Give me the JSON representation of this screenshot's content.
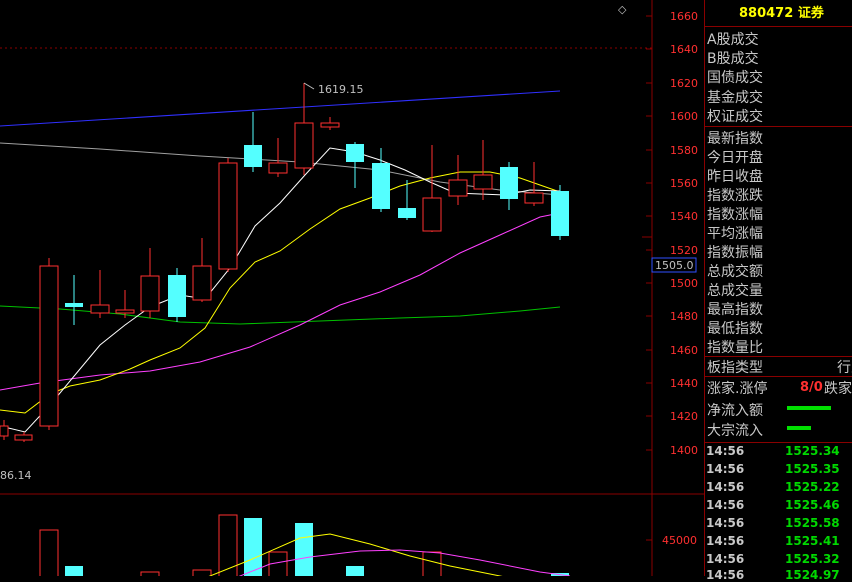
{
  "header": {
    "code": "880472",
    "name": "证券",
    "diamond": "◇"
  },
  "axis": {
    "labels": [
      "1660",
      "1640",
      "1620",
      "1600",
      "1580",
      "1560",
      "1540",
      "1520",
      "1500",
      "1480",
      "1460",
      "1440",
      "1420",
      "1400"
    ]
  },
  "current_price_label": "1505.0",
  "annotations": {
    "high": "1619.15",
    "low": "86.14"
  },
  "volume_axis": {
    "label": "45000"
  },
  "info_labels": [
    "A股成交",
    "B股成交",
    "国债成交",
    "基金成交",
    "权证成交",
    "最新指数",
    "今日开盘",
    "昨日收盘",
    "指数涨跌",
    "指数涨幅",
    "平均涨幅",
    "指数振幅",
    "总成交额",
    "总成交量",
    "最高指数",
    "最低指数",
    "指数量比",
    "板指类型",
    "涨家.涨停",
    "净流入额",
    "大宗流入"
  ],
  "info_values": {
    "board_type": "行业",
    "up_count": "8/0",
    "down_label": "跌家"
  },
  "ticks": [
    {
      "time": "14:56",
      "price": "1525.34"
    },
    {
      "time": "14:56",
      "price": "1525.35"
    },
    {
      "time": "14:56",
      "price": "1525.22"
    },
    {
      "time": "14:56",
      "price": "1525.46"
    },
    {
      "time": "14:56",
      "price": "1525.58"
    },
    {
      "time": "14:56",
      "price": "1525.41"
    },
    {
      "time": "14:56",
      "price": "1525.32"
    },
    {
      "time": "14:56",
      "price": "1524.97"
    }
  ],
  "colors": {
    "up": "#ff3030",
    "down": "#54ffff",
    "border": "#8a0000",
    "ma5": "#ffffff",
    "ma10": "#ffff00",
    "ma20": "#ff40ff",
    "ma60": "#00e000",
    "trend": "#3030ff"
  }
}
